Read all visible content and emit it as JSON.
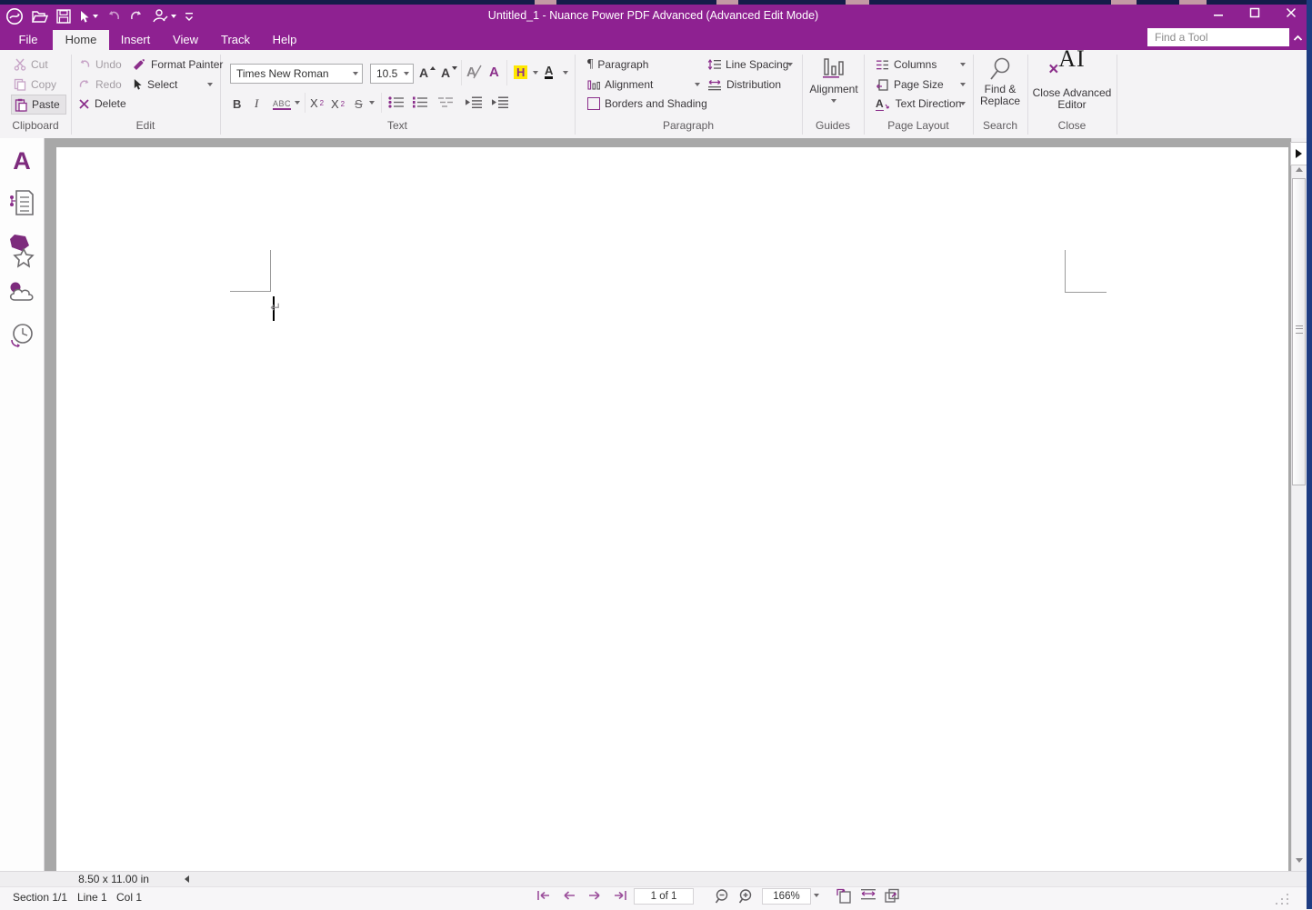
{
  "window": {
    "title": "Untitled_1 - Nuance Power PDF Advanced (Advanced Edit Mode)"
  },
  "menu": {
    "tabs": [
      {
        "label": "File"
      },
      {
        "label": "Home"
      },
      {
        "label": "Insert"
      },
      {
        "label": "View"
      },
      {
        "label": "Track"
      },
      {
        "label": "Help"
      }
    ]
  },
  "search": {
    "placeholder": "Find a Tool"
  },
  "ribbon": {
    "clipboard": {
      "label": "Clipboard",
      "cut": "Cut",
      "copy": "Copy",
      "paste": "Paste"
    },
    "edit": {
      "label": "Edit",
      "undo": "Undo",
      "redo": "Redo",
      "delete": "Delete",
      "format_painter": "Format Painter",
      "select": "Select"
    },
    "text": {
      "label": "Text",
      "font_name": "Times New Roman",
      "font_size": "10.5",
      "grow": "A",
      "shrink": "A",
      "clear": "A",
      "color_a": "A",
      "highlight": "H",
      "font_color": "A",
      "bold": "B",
      "italic": "I",
      "underline": "ABC",
      "superscript_base": "X",
      "superscript_mark": "2",
      "subscript_base": "X",
      "subscript_mark": "2",
      "strikethrough": "S"
    },
    "paragraph": {
      "label": "Paragraph",
      "pilcrow_icon": "¶",
      "paragraph": "Paragraph",
      "alignment": "Alignment",
      "borders": "Borders and Shading",
      "line_spacing": "Line Spacing",
      "distribution": "Distribution"
    },
    "guides": {
      "label": "Guides",
      "alignment": "Alignment"
    },
    "page_layout": {
      "label": "Page Layout",
      "columns": "Columns",
      "page_size": "Page Size",
      "text_direction": "Text Direction",
      "td_letter": "A"
    },
    "search_group": {
      "label": "Search",
      "find_line1": "Find &",
      "find_line2": "Replace"
    },
    "close_group": {
      "label": "Close",
      "close_line1": "Close Advanced",
      "close_line2": "Editor",
      "ai_icon": "AI",
      "x_icon": "×"
    }
  },
  "sidebar": {
    "text_tool": "A"
  },
  "document": {
    "pilcrow": "↵"
  },
  "hscroll": {
    "page_dimensions": "8.50 x 11.00 in"
  },
  "statusbar": {
    "section": "Section 1/1",
    "line": "Line 1",
    "column": "Col 1",
    "page_indicator": "1 of 1",
    "zoom_level": "166%"
  },
  "colors": {
    "titlebar": "#8e2191",
    "accent": "#8b2f8b",
    "highlight": "#ffe800",
    "desktop_edge": "#1e3c82",
    "doc_gray": "#a8a8a8"
  }
}
